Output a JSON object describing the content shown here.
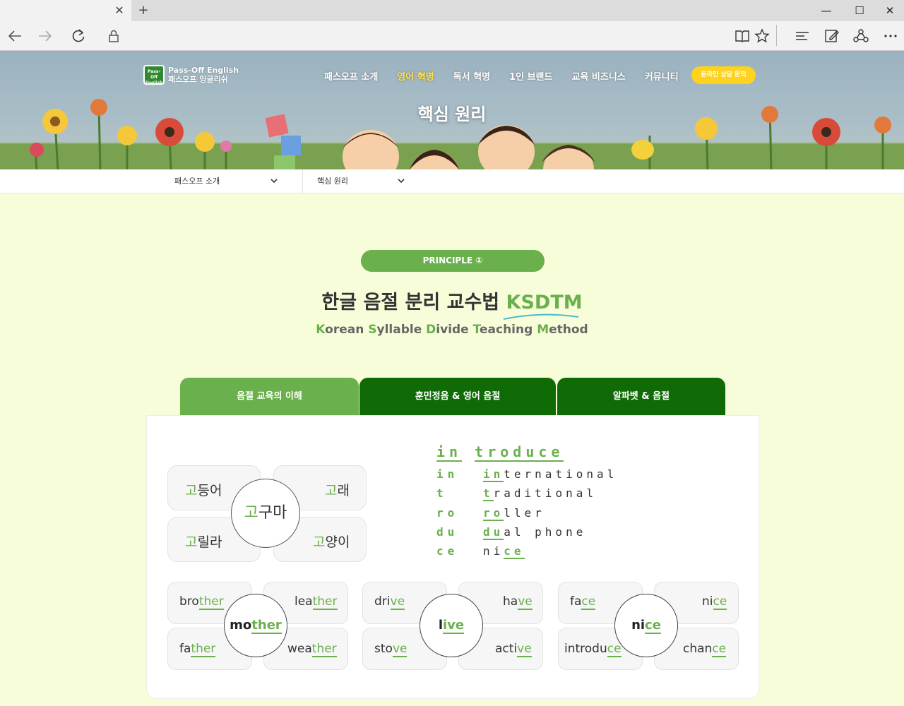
{
  "browser": {
    "tab_close": "✕",
    "new_tab": "+",
    "win": {
      "min": "—",
      "max": "☐",
      "close": "✕"
    }
  },
  "logo": {
    "line1": "Pass-Off English",
    "line2": "패스오프 잉글리쉬",
    "badge": "Pass-Off English"
  },
  "nav": {
    "items": [
      "패스오프 소개",
      "영어 혁명",
      "독서 혁명",
      "1인 브랜드",
      "교육 비즈니스",
      "커뮤니티"
    ],
    "consult": "온라인 상담 문의"
  },
  "hero": {
    "title": "핵심 원리"
  },
  "subnav": {
    "first": "패스오프 소개",
    "second": "핵심 원리"
  },
  "section": {
    "badge": "PRINCIPLE ①",
    "title_main": "한글 음절 분리 교수법 ",
    "title_accent": "KSDTM",
    "subtitle_parts": [
      {
        "g": "K",
        "t": "orean "
      },
      {
        "g": "S",
        "t": "yllable "
      },
      {
        "g": "D",
        "t": "ivide "
      },
      {
        "g": "T",
        "t": "eaching "
      },
      {
        "g": "M",
        "t": "ethod"
      }
    ]
  },
  "tabs": [
    "음절 교육의 이해",
    "훈민정음 & 영어 음절",
    "알파벳 & 음절"
  ],
  "colors": {
    "accent": "#6ab04c",
    "tab_active": "#6ab04c",
    "tab_inactive": "#106b06",
    "consult": "#ffd21e",
    "bg": "#f8fdd9"
  },
  "korean_cluster": {
    "center": {
      "g": "고",
      "t": "구마"
    },
    "pills": [
      {
        "g": "고",
        "t": "등어"
      },
      {
        "g": "고",
        "t": "래"
      },
      {
        "g": "고",
        "t": "릴라"
      },
      {
        "g": "고",
        "t": "양이"
      }
    ]
  },
  "introduce": {
    "word": [
      "in",
      "t",
      "ro",
      "du",
      "ce"
    ],
    "rows": [
      {
        "syl": "in",
        "g": "in",
        "t": "ternational"
      },
      {
        "syl": "t",
        "g": "t",
        "t": "raditional"
      },
      {
        "syl": "ro",
        "g": "ro",
        "t": "ller"
      },
      {
        "syl": "du",
        "g": "du",
        "t": "al phone"
      },
      {
        "syl": "ce",
        "pre": "ni",
        "g": "ce",
        "t": ""
      }
    ]
  },
  "english_clusters": [
    {
      "center": {
        "t": "mo",
        "g": "ther"
      },
      "pills": [
        {
          "t": "bro",
          "g": "ther"
        },
        {
          "t": "lea",
          "g": "ther"
        },
        {
          "t": "fa",
          "g": "ther"
        },
        {
          "t": "wea",
          "g": "ther"
        }
      ]
    },
    {
      "center": {
        "t": "l",
        "g": "ive"
      },
      "pills": [
        {
          "t": "dri",
          "g": "ve"
        },
        {
          "t": "ha",
          "g": "ve"
        },
        {
          "t": "sto",
          "g": "ve"
        },
        {
          "t": "acti",
          "g": "ve"
        }
      ]
    },
    {
      "center": {
        "t": "ni",
        "g": "ce"
      },
      "pills": [
        {
          "t": "fa",
          "g": "ce"
        },
        {
          "t": "ni",
          "g": "ce"
        },
        {
          "t": "introdu",
          "g": "ce"
        },
        {
          "t": "chan",
          "g": "ce"
        }
      ]
    }
  ]
}
